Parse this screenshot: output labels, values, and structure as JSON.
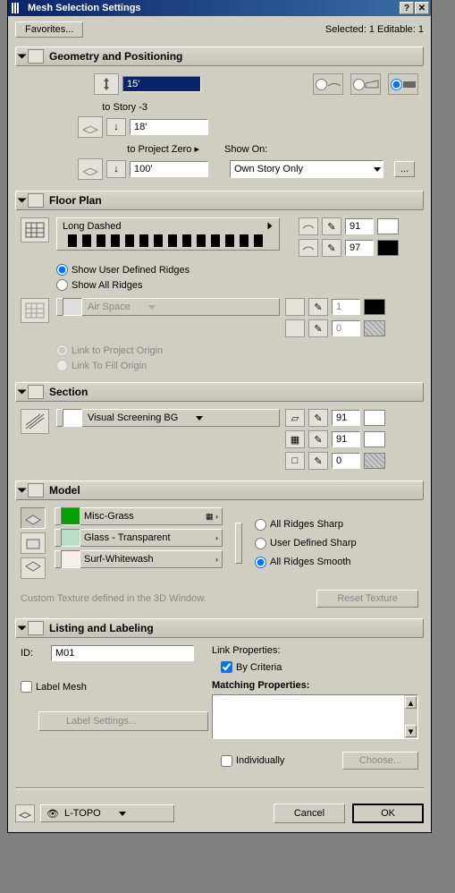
{
  "window": {
    "title": "Mesh Selection Settings"
  },
  "toolbar": {
    "favorites": "Favorites...",
    "status": "Selected: 1 Editable: 1"
  },
  "sections": {
    "geometry": {
      "title": "Geometry and Positioning",
      "height": "15'",
      "story_label": "to Story -3",
      "story_value": "18'",
      "zero_label": "to Project Zero ▸",
      "zero_value": "100'",
      "show_on_label": "Show On:",
      "show_on_value": "Own Story Only",
      "more_btn": "..."
    },
    "floorplan": {
      "title": "Floor Plan",
      "linetype": "Long Dashed",
      "pen1": "91",
      "pen2": "97",
      "ridge_options": {
        "user": "Show User Defined Ridges",
        "all": "Show All Ridges"
      },
      "airspace": "Air Space",
      "airpen1": "1",
      "airpen2": "0",
      "link_origin": "Link to Project Origin",
      "link_fill": "Link To Fill Origin"
    },
    "section": {
      "title": "Section",
      "fill": "Visual Screening BG",
      "pen1": "91",
      "pen2": "91",
      "pen3": "0"
    },
    "model": {
      "title": "Model",
      "top_material": "Misc-Grass",
      "side_material": "Glass - Transparent",
      "bottom_material": "Surf-Whitewash",
      "ridge_options": {
        "sharp": "All Ridges Sharp",
        "user": "User Defined Sharp",
        "smooth": "All Ridges Smooth"
      },
      "texture_note": "Custom Texture defined in the 3D Window.",
      "reset_btn": "Reset Texture"
    },
    "listing": {
      "title": "Listing and Labeling",
      "id_label": "ID:",
      "id_value": "M01",
      "label_mesh": "Label Mesh",
      "label_settings_btn": "Label Settings...",
      "link_props": "Link Properties:",
      "by_criteria": "By Criteria",
      "matching": "Matching Properties:",
      "individually": "Individually",
      "choose_btn": "Choose..."
    }
  },
  "footer": {
    "layer_value": "L-TOPO",
    "cancel": "Cancel",
    "ok": "OK"
  }
}
